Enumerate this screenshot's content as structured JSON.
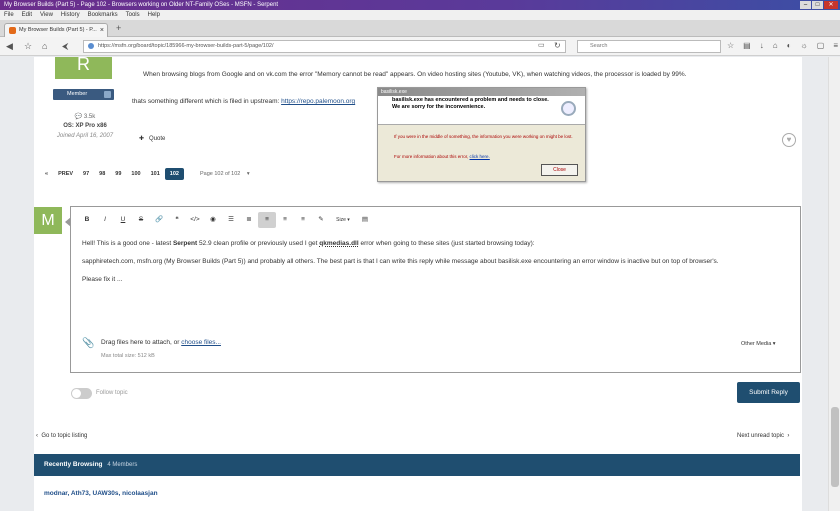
{
  "window": {
    "title": "My Browser Builds (Part 5) - Page 102 - Browsers working on Older NT-Family OSes - MSFN - Serpent"
  },
  "menu": [
    "File",
    "Edit",
    "View",
    "History",
    "Bookmarks",
    "Tools",
    "Help"
  ],
  "tab": {
    "label": "My Browser Builds (Part 5) - P..."
  },
  "navbar": {
    "url": "https://msfn.org/board/topic/185966-my-browser-builds-part-5/page/102/",
    "search_placeholder": "Search"
  },
  "post": {
    "line1": "When browsing blogs from Google and on vk.com the error \"Memory cannot be read\" appears. On video hosting sites (Youtube, VK), when watching videos, the processor is loaded by 99%.",
    "line2_prefix": "thats something different which is filed in upstream: ",
    "line2_link": "https://repo.palemoon.org",
    "quote_label": "Quote"
  },
  "user": {
    "avatar_letter": "R",
    "badge": "Member",
    "reputation": "3.5k",
    "os": "OS: XP Pro x86",
    "joined": "Joined April 16, 2007"
  },
  "pagination": {
    "prev": "PREV",
    "pages": [
      "97",
      "98",
      "99",
      "100",
      "101",
      "102"
    ],
    "current": "102",
    "page_of": "Page 102 of 102"
  },
  "error_dialog": {
    "title": "basilisk.exe",
    "heading": "basilisk.exe has encountered a problem and needs to close.  We are sorry for the inconvenience.",
    "text1": "If you were in the middle of something, the information you were working on might be lost.",
    "text2_prefix": "For more information about this error, ",
    "text2_link": "click here.",
    "close_label": "Close"
  },
  "reply": {
    "avatar_letter": "M",
    "size_label": "Size",
    "para1_a": "Hell! This is a good one - latest ",
    "para1_b": "Serpent",
    "para1_c": " 52.9 clean profile or previously used I get ",
    "para1_d": "qkmedias.dll",
    "para1_e": " error when going to these sites (just started browsing today):",
    "para2": "sapphiretech.com, msfn.org (My Browser Builds (Part 5)) and probably all others. The best part is that I can write this reply while message about basilisk.exe encountering an error window is inactive but on top of browser's.",
    "para3": "Please fix it ...",
    "attach_prefix": "Drag files here to attach, or ",
    "attach_link": "choose files...",
    "max_size": "Max total size: 512 kB",
    "other_media": "Other Media",
    "follow": "Follow topic",
    "submit": "Submit Reply"
  },
  "nav": {
    "back": "Go to topic listing",
    "next": "Next unread topic"
  },
  "recent": {
    "title": "Recently Browsing",
    "count": "4 Members",
    "members": "modnar, Ath73, UAW30s, nicolaasjan"
  }
}
